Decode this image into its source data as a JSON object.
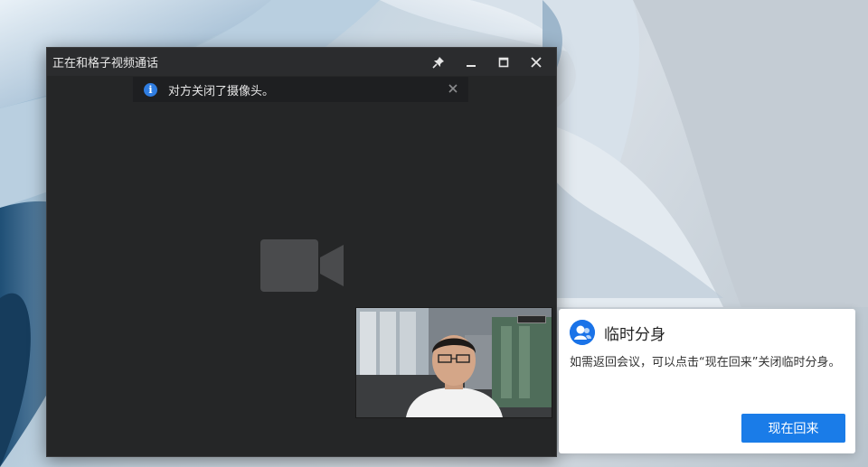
{
  "window": {
    "title": "正在和格子视频通话",
    "buttons": {
      "pin_icon": "pin-icon",
      "minimize_icon": "minimize-icon",
      "maximize_icon": "maximize-icon",
      "close_icon": "close-icon"
    }
  },
  "notice": {
    "icon": "info-icon",
    "icon_glyph": "i",
    "text": "对方关闭了摄像头。",
    "close_icon": "close-icon"
  },
  "video": {
    "placeholder_icon": "video-camera-icon"
  },
  "clone_popup": {
    "icon": "user-avatar-icon",
    "title": "临时分身",
    "description": "如需返回会议，可以点击“现在回来”关闭临时分身。",
    "button_label": "现在回来"
  },
  "colors": {
    "accent": "#1a7ce8",
    "window_bg": "#252627",
    "titlebar_bg": "#2b2c2e"
  }
}
